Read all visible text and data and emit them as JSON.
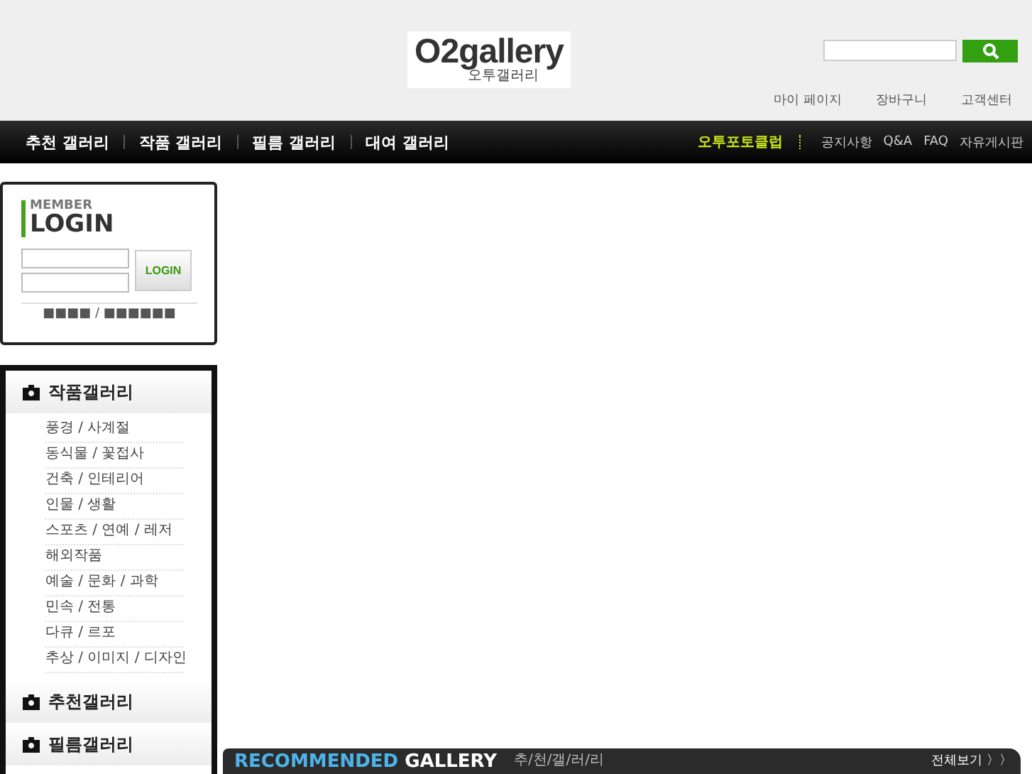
{
  "logo": {
    "text": "O2gallery",
    "subtitle": "오투갤러리"
  },
  "top_links": [
    "마이 페이지",
    "장바구니",
    "고객센터"
  ],
  "nav": {
    "left": [
      "추천 갤러리",
      "작품 갤러리",
      "필름 갤러리",
      "대여 갤러리"
    ],
    "highlight": "오투포토클럽",
    "right": [
      "공지사항",
      "Q&A",
      "FAQ",
      "자유게시판"
    ]
  },
  "login": {
    "title_small": "MEMBER",
    "title": "LOGIN",
    "button": "LOGIN",
    "links": "■■■■ / ■■■■■■"
  },
  "sidebar": [
    {
      "title": "작품갤러리",
      "items": [
        "풍경 / 사계절",
        "동식물 / 꽃접사",
        "건축 / 인테리어",
        "인물 / 생활",
        "스포츠 / 연예 / 레저",
        "해외작품",
        "예술 / 문화 / 과학",
        "민속 / 전통",
        "다큐 / 르포",
        "추상 / 이미지 / 디자인"
      ]
    },
    {
      "title": "추천갤러리"
    },
    {
      "title": "필름갤러리"
    }
  ],
  "recommended": {
    "title_accent": "RECOMMENDED",
    "title": "GALLERY",
    "subtitle": "추/천/갤/러/리",
    "more": "전체보기 〉〉"
  }
}
